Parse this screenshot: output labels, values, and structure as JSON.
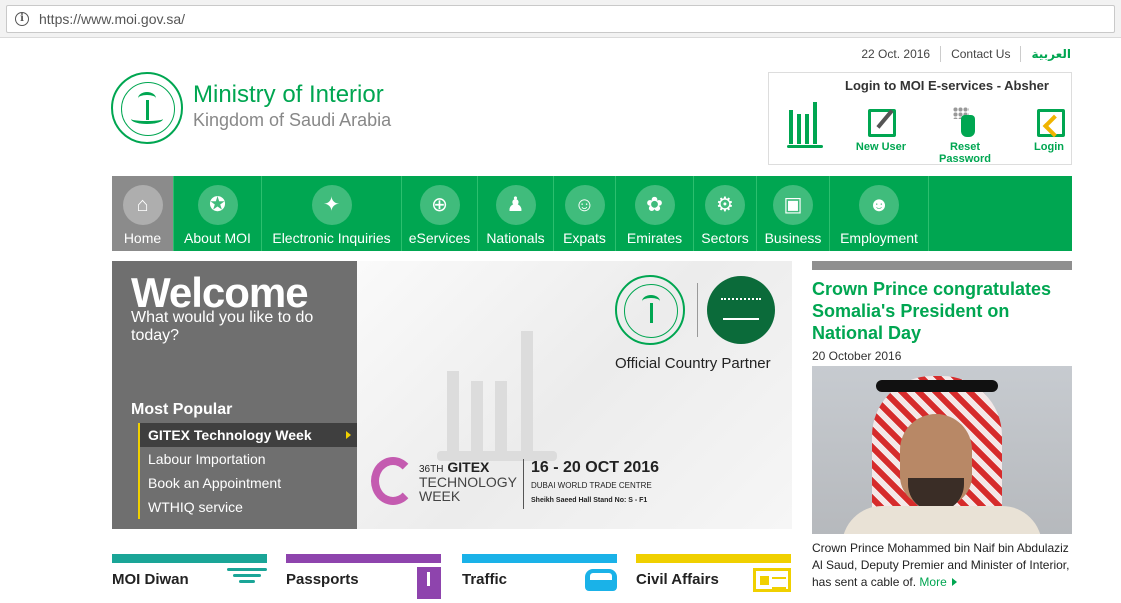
{
  "browser": {
    "url": "https://www.moi.gov.sa/"
  },
  "toplinks": {
    "date": "22 Oct. 2016",
    "contact": "Contact Us",
    "arabic": "العربية"
  },
  "logo": {
    "title": "Ministry of Interior",
    "subtitle": "Kingdom of Saudi Arabia"
  },
  "absher": {
    "title": "Login to MOI E-services - Absher",
    "actions": [
      {
        "label": "New User",
        "icon": "new-user-icon"
      },
      {
        "label": "Reset Password",
        "icon": "reset-password-icon"
      },
      {
        "label": "Login",
        "icon": "login-icon"
      }
    ]
  },
  "nav": {
    "items": [
      {
        "label": "Home",
        "glyph": "⌂",
        "width": 62,
        "active": true
      },
      {
        "label": "About MOI",
        "glyph": "✪",
        "width": 88
      },
      {
        "label": "Electronic Inquiries",
        "glyph": "✦",
        "width": 140
      },
      {
        "label": "eServices",
        "glyph": "⊕",
        "width": 76
      },
      {
        "label": "Nationals",
        "glyph": "♟",
        "width": 76
      },
      {
        "label": "Expats",
        "glyph": "☺",
        "width": 62
      },
      {
        "label": "Emirates",
        "glyph": "✿",
        "width": 78
      },
      {
        "label": "Sectors",
        "glyph": "⚙",
        "width": 63
      },
      {
        "label": "Business",
        "glyph": "▣",
        "width": 73
      },
      {
        "label": "Employment",
        "glyph": "☻",
        "width": 99
      }
    ]
  },
  "welcome": {
    "title": "Welcome",
    "subtitle": "What would you like to do today?",
    "most_popular_title": "Most Popular",
    "most_popular": [
      {
        "label": "GITEX Technology Week",
        "active": true
      },
      {
        "label": "Labour Importation"
      },
      {
        "label": "Book an Appointment"
      },
      {
        "label": "WTHIQ service"
      }
    ]
  },
  "banner": {
    "partner_text": "Official Country Partner",
    "gitex_edition": "36",
    "gitex_th": "TH",
    "gitex_name": "GITEX",
    "gitex_line2": "TECHNOLOGY",
    "gitex_line3": "WEEK",
    "date": "16 - 20 OCT 2016",
    "venue": "DUBAI WORLD TRADE CENTRE",
    "stand": "Sheikh Saeed Hall Stand No: S - F1"
  },
  "news": {
    "title": "Crown Prince congratulates Somalia's President on National Day",
    "date": "20 October 2016",
    "desc": "Crown Prince Mohammed bin Naif bin Abdulaziz Al Saud, Deputy Premier and Minister of Interior, has sent a cable of.",
    "more": "More"
  },
  "tiles": [
    {
      "label": "MOI Diwan",
      "icon": "diwan-icon"
    },
    {
      "label": "Passports",
      "icon": "passport-icon"
    },
    {
      "label": "Traffic",
      "icon": "car-icon"
    },
    {
      "label": "Civil Affairs",
      "icon": "id-card-icon"
    }
  ],
  "colors": {
    "brand_green": "#00a651",
    "nav_active": "#8b8b8b",
    "diwan": "#1aa597",
    "passports": "#8e44ad",
    "traffic": "#1ab2e8",
    "civil": "#f0d000"
  }
}
